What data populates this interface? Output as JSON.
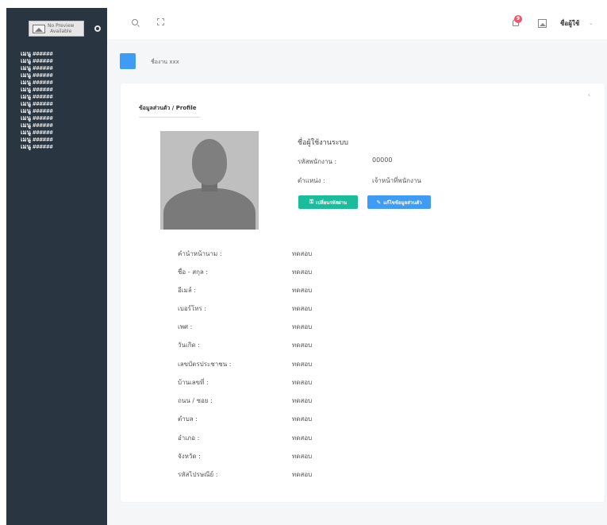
{
  "sidebar": {
    "logo_line1": "No Preview",
    "logo_line2": "Available",
    "menu_items": [
      "เมนู ######",
      "เมนู ######",
      "เมนู ######",
      "เมนู ######",
      "เมนู ######",
      "เมนู ######",
      "เมนู ######",
      "เมนู ######",
      "เมนู ######",
      "เมนู ######",
      "เมนู ######",
      "เมนู ######",
      "เมนู ######",
      "เมนู ######"
    ]
  },
  "topbar": {
    "notification_count": "9",
    "username": "ชื่อผู้ใช้",
    "caret": "⌄"
  },
  "page": {
    "title": "ชื่องาน xxx"
  },
  "card": {
    "collapse": "‹",
    "heading": "ข้อมูลส่วนตัว / Profile",
    "profile": {
      "system_username": "ชื่อผู้ใช้งานระบบ",
      "employee_id_label": "รหัสพนักงาน :",
      "employee_id_value": "00000",
      "position_label": "ตำแหน่ง :",
      "position_value": "เจ้าหน้าที่พนักงาน"
    },
    "buttons": {
      "change_password": "เปลี่ยนรหัสผ่าน",
      "edit_profile": "แก้ไขข้อมูลส่วนตัว"
    },
    "rows": [
      {
        "label": "คำนำหน้านาม :",
        "value": "ทดสอบ"
      },
      {
        "label": "ชื่อ - สกุล :",
        "value": "ทดสอบ"
      },
      {
        "label": "อีเมล์ :",
        "value": "ทดสอบ"
      },
      {
        "label": "เบอร์โทร :",
        "value": "ทดสอบ"
      },
      {
        "label": "เพศ :",
        "value": "ทดสอบ"
      },
      {
        "label": "วันเกิด :",
        "value": "ทดสอบ"
      },
      {
        "label": "เลขบัตรประชาชน :",
        "value": "ทดสอบ"
      },
      {
        "label": "บ้านเลขที่ :",
        "value": "ทดสอบ"
      },
      {
        "label": "ถนน / ซอย :",
        "value": "ทดสอบ"
      },
      {
        "label": "ตำบล :",
        "value": "ทดสอบ"
      },
      {
        "label": "อำเภอ :",
        "value": "ทดสอบ"
      },
      {
        "label": "จังหวัด :",
        "value": "ทดสอบ"
      },
      {
        "label": "รหัสไปรษณีย์ :",
        "value": "ทดสอบ"
      }
    ]
  },
  "colors": {
    "sidebar_bg": "#2a3542",
    "accent_blue": "#3f9cf5",
    "accent_green": "#1abc9c",
    "badge_red": "#f1556c"
  }
}
